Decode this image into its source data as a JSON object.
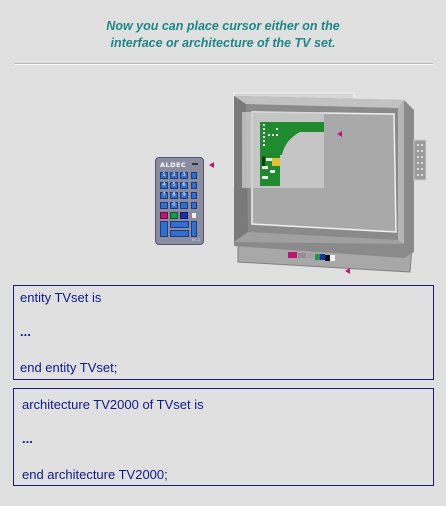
{
  "heading": {
    "line1": "Now you can place cursor either on the",
    "line2": "interface or architecture of the TV set."
  },
  "remote": {
    "brand": "ALDEC",
    "keys": [
      "1",
      "2",
      "3",
      "",
      "4",
      "5",
      "6",
      "",
      "7",
      "8",
      "9",
      "",
      "",
      "0",
      "",
      ""
    ],
    "model": "RC-3"
  },
  "entity_box": {
    "line1": "entity TVset is",
    "ellipsis": "...",
    "line3": "end entity TVset;"
  },
  "architecture_box": {
    "line1": "architecture TV2000 of TVset is",
    "ellipsis": "...",
    "line3": "end architecture TV2000;"
  },
  "colors": {
    "heading": "#1a8a86",
    "code_text": "#0d1a8c",
    "box_border": "#1b1b7a",
    "pointer": "#c0156e",
    "background": "#e0e0e0"
  }
}
